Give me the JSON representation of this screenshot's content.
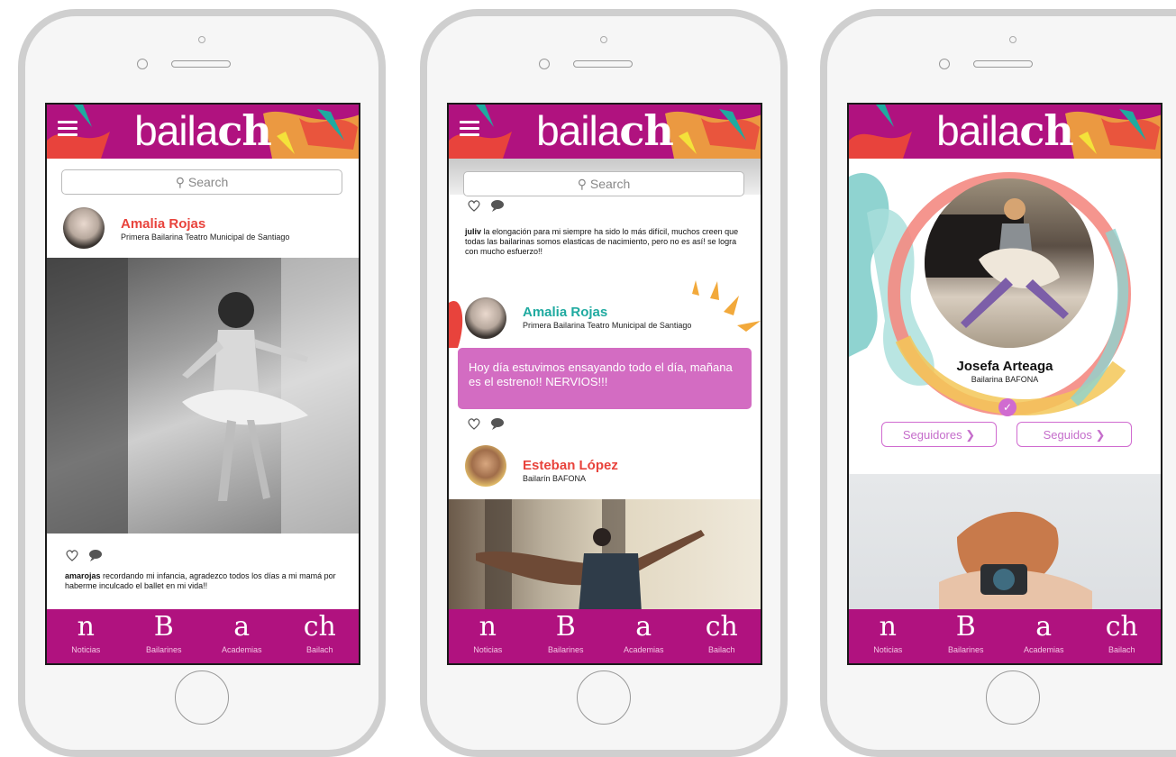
{
  "app": {
    "logo_text_a": "baila",
    "logo_text_b": "ch"
  },
  "search": {
    "placeholder": "Search"
  },
  "nav": [
    {
      "glyph": "n",
      "label": "Noticias"
    },
    {
      "glyph": "B",
      "label": "Bailarines"
    },
    {
      "glyph": "a",
      "label": "Academias"
    },
    {
      "glyph": "ch",
      "label": "Bailach"
    }
  ],
  "screen1": {
    "post": {
      "author": "Amalia Rojas",
      "role": "Primera Bailarina Teatro Municipal de Santiago",
      "caption_user": "amarojas",
      "caption_text": " recordando mi infancia, agradezco todos los días a mi mamá por haberme inculcado el ballet en mi vida!!"
    }
  },
  "screen2": {
    "comment_user": "juliv",
    "comment_text": " la elongación para mi siempre ha sido lo más difícil, muchos creen que todas las bailarinas somos elasticas de nacimiento, pero no es así! se logra con mucho esfuerzo!!",
    "post": {
      "author": "Amalia Rojas",
      "role": "Primera Bailarina Teatro Municipal de Santiago",
      "message": "Hoy día estuvimos ensayando todo el día, mañana es el estreno!! NERVIOS!!!"
    },
    "post2": {
      "author": "Esteban López",
      "role": "Bailarín BAFONA"
    }
  },
  "screen3": {
    "profile": {
      "name": "Josefa Arteaga",
      "role": "Bailarina BAFONA",
      "followers_label": "Seguidores",
      "following_label": "Seguidos"
    }
  },
  "colors": {
    "brand": "#b0127f",
    "accent_red": "#e8433c",
    "accent_teal": "#1faaa0",
    "bubble": "#d36cc2"
  }
}
